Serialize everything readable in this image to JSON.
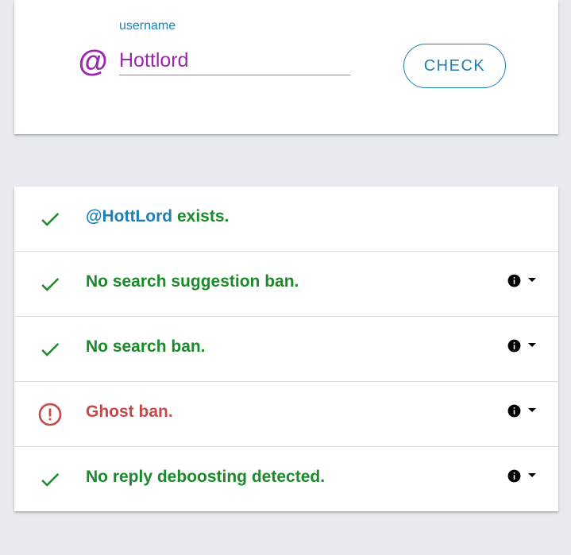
{
  "search": {
    "at_symbol": "@",
    "label": "username",
    "value": "Hottlord",
    "check_label": "CHECK"
  },
  "results": [
    {
      "status": "ok",
      "icon": "check-icon",
      "handle": "@HottLord",
      "text": " exists.",
      "has_details": false
    },
    {
      "status": "ok",
      "icon": "check-icon",
      "text": "No search suggestion ban.",
      "has_details": true
    },
    {
      "status": "ok",
      "icon": "check-icon",
      "text": "No search ban.",
      "has_details": true
    },
    {
      "status": "warn",
      "icon": "alert-circle-icon",
      "text": "Ghost ban.",
      "has_details": true
    },
    {
      "status": "ok",
      "icon": "check-icon",
      "text": "No reply deboosting detected.",
      "has_details": true
    }
  ],
  "colors": {
    "accent": "#1f7fb3",
    "at_symbol": "#9c27b0",
    "ok": "#1b8a2a",
    "warn": "#c24a4a",
    "background": "#e7ebef"
  }
}
